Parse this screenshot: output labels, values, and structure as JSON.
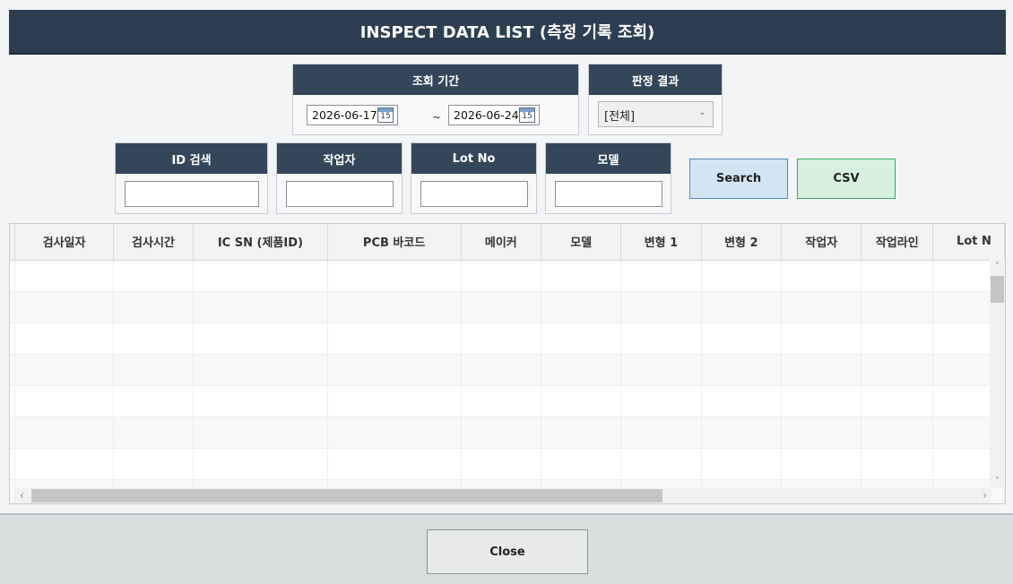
{
  "title": "INSPECT DATA LIST (측정 기록 조회)",
  "period": {
    "label": "조회 기간",
    "start": "2026-06-17",
    "end": "2026-06-24",
    "separator": "~",
    "cal_day": "15"
  },
  "judgement": {
    "label": "판정 결과",
    "selected": "[전체]"
  },
  "filters": {
    "id_label": "ID 검색",
    "worker_label": "작업자",
    "lot_label": "Lot No",
    "model_label": "모델",
    "id_value": "",
    "worker_value": "",
    "lot_value": "",
    "model_value": ""
  },
  "buttons": {
    "search": "Search",
    "csv": "CSV",
    "close": "Close"
  },
  "table": {
    "columns": [
      "검사일자",
      "검사시간",
      "IC SN (제품ID)",
      "PCB 바코드",
      "메이커",
      "모델",
      "변형 1",
      "변형 2",
      "작업자",
      "작업라인",
      "Lot N"
    ],
    "rows": []
  },
  "scroll": {
    "up": "˄",
    "down": "˅",
    "left": "‹",
    "right": "›"
  },
  "colors": {
    "header_dark": "#2d3e51",
    "search_btn": "#d3e5f3",
    "csv_btn": "#d7f0df"
  }
}
